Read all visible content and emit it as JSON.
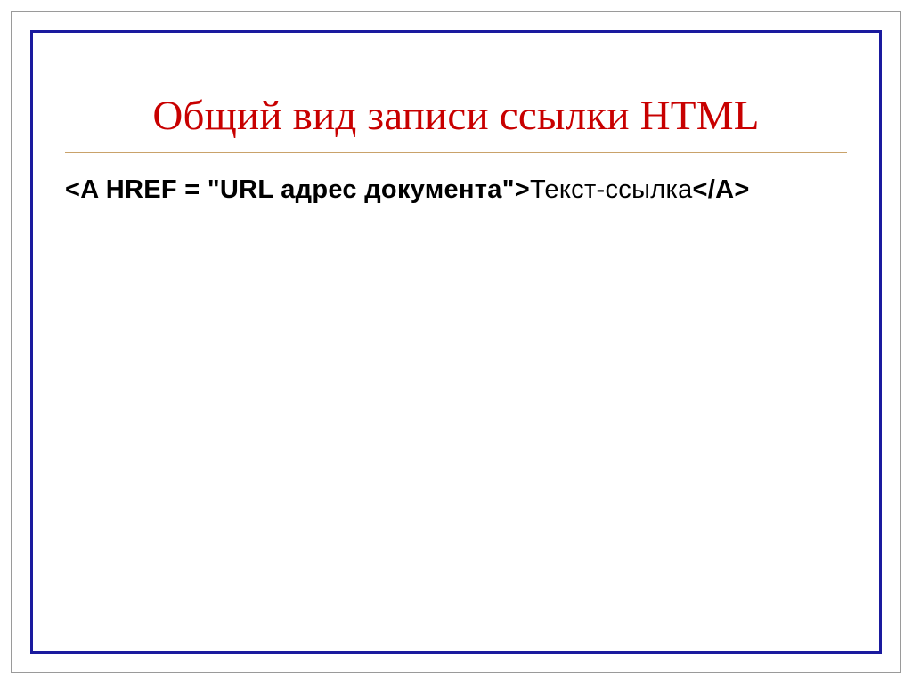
{
  "slide": {
    "title": "Общий вид записи ссылки HTML",
    "body_bold": "<A HREF = \"URL адрес документа\">",
    "body_normal": "Текст-ссылка",
    "body_bold_end": "</A>"
  },
  "colors": {
    "title": "#c80000",
    "inner_border": "#1a1a9e",
    "outer_border": "#9a9a9a",
    "rule": "#c9a26a"
  }
}
